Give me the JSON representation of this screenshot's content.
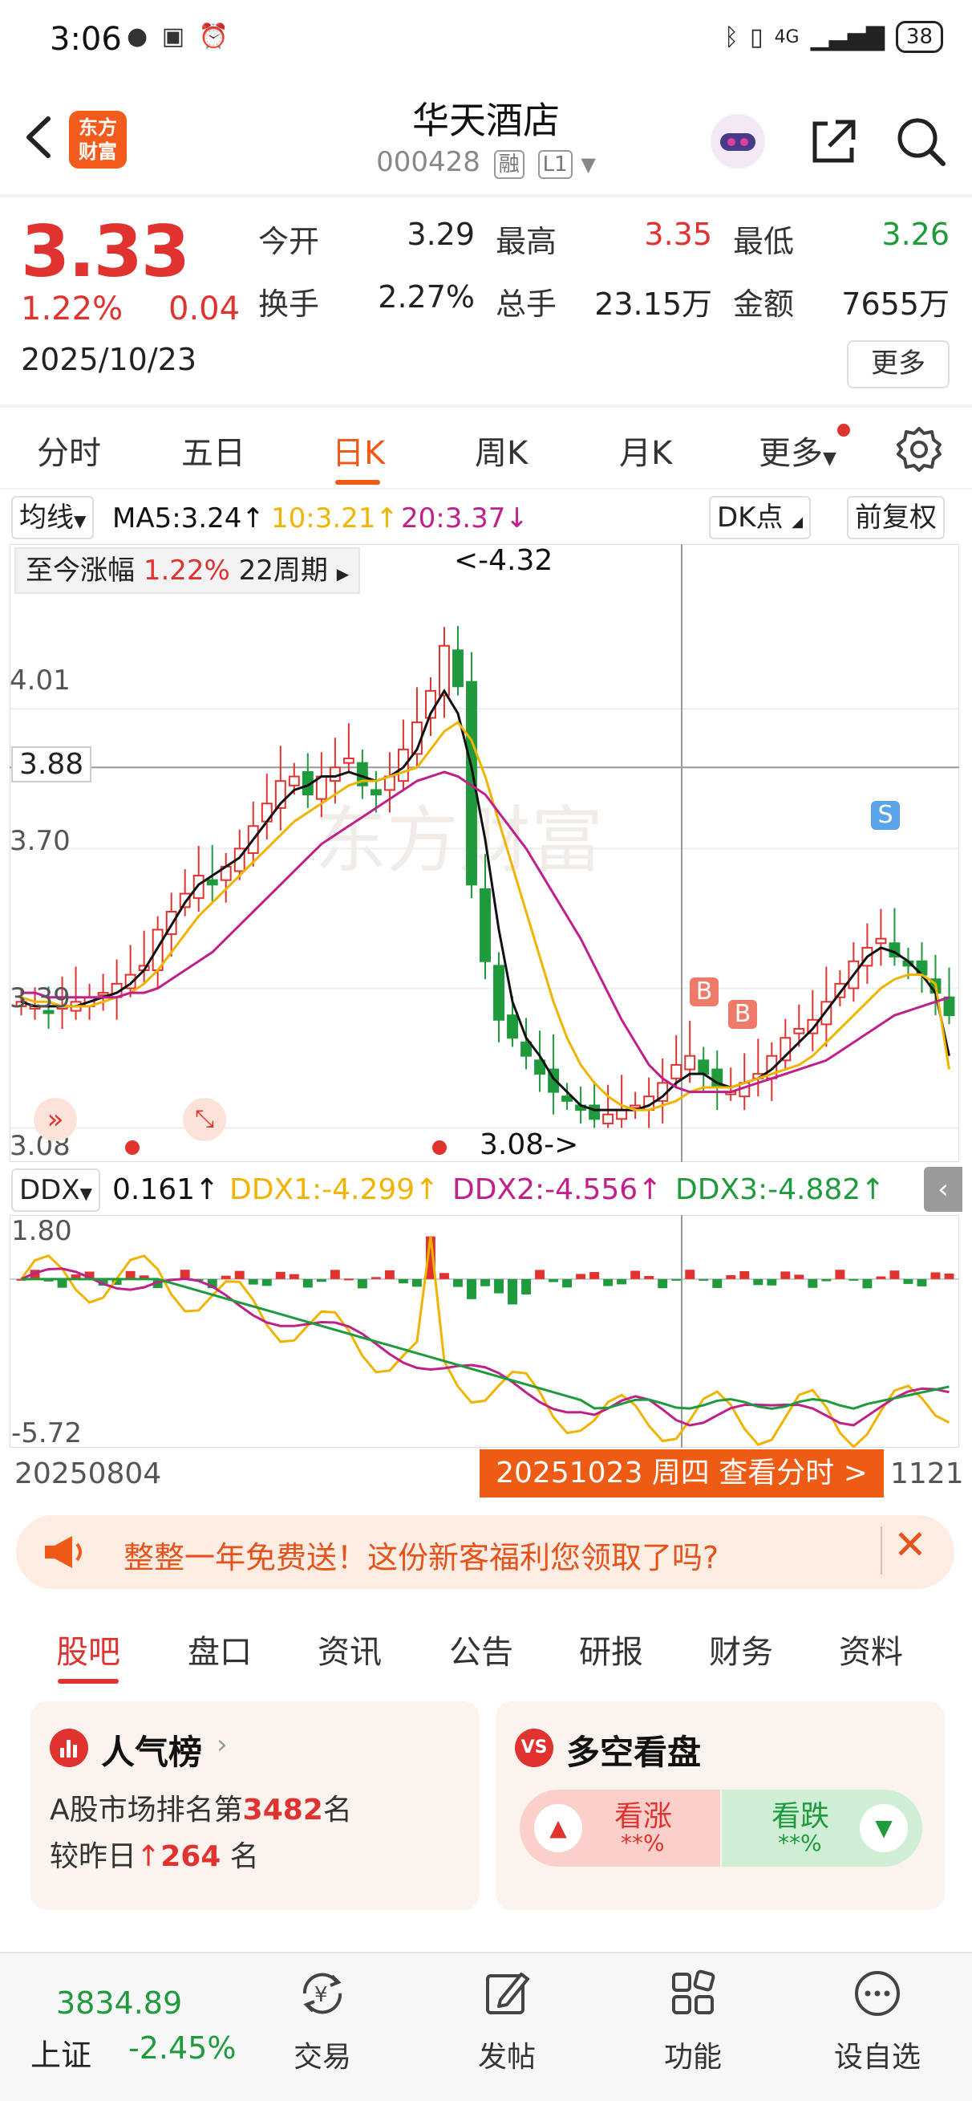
{
  "status_bar": {
    "time": "3:06",
    "battery": "38",
    "network": "4G"
  },
  "header": {
    "app_logo_line1": "东方",
    "app_logo_line2": "财富",
    "stock_name": "华天酒店",
    "stock_code": "000428",
    "tag_margin": "融",
    "tag_level": "L1"
  },
  "quote": {
    "price": "3.33",
    "change_pct": "1.22%",
    "change_amt": "0.04",
    "date": "2025/10/23",
    "open_label": "今开",
    "open_value": "3.29",
    "high_label": "最高",
    "high_value": "3.35",
    "low_label": "最低",
    "low_value": "3.26",
    "turnover_label": "换手",
    "turnover_value": "2.27%",
    "volume_label": "总手",
    "volume_value": "23.15万",
    "amount_label": "金额",
    "amount_value": "7655万",
    "more_label": "更多"
  },
  "kline_tabs": [
    "分时",
    "五日",
    "日K",
    "周K",
    "月K",
    "更多"
  ],
  "active_kline_tab": "日K",
  "ma_bar": {
    "selector": "均线",
    "ma5": "MA5:3.24↑",
    "ma10": "10:3.21↑",
    "ma20": "20:3.37↓",
    "dk_label": "DK点",
    "adjust_label": "前复权"
  },
  "chart_overlay": {
    "range_label": "至今涨幅",
    "range_pct": "1.22%",
    "range_period": "22周期",
    "high_marker": "<-4.32",
    "low_marker": "3.08->",
    "crosshair_value": "3.88",
    "buy_label": "B",
    "sell_label": "S"
  },
  "ddx_bar": {
    "selector": "DDX",
    "ddx": "0.161↑",
    "ddx1": "DDX1:-4.299↑",
    "ddx2": "DDX2:-4.556↑",
    "ddx3": "DDX3:-4.882↑"
  },
  "date_bar": {
    "start": "20250804",
    "end": "1121",
    "tip": "20251023 周四 查看分时 >"
  },
  "banner": {
    "text": "整整一年免费送！这份新客福利您领取了吗?"
  },
  "content_tabs": [
    "股吧",
    "盘口",
    "资讯",
    "公告",
    "研报",
    "财务",
    "资料"
  ],
  "active_content_tab": "股吧",
  "card_popularity": {
    "title": "人气榜",
    "rank_prefix": "A股市场排名第",
    "rank_value": "3482",
    "rank_suffix": "名",
    "change_prefix": "较昨日",
    "change_value": "264",
    "change_suffix": "名"
  },
  "card_vote": {
    "title": "多空看盘",
    "up_label": "看涨",
    "up_pct": "**%",
    "down_label": "看跌",
    "down_pct": "**%"
  },
  "bottom_nav": {
    "index_value": "3834.89",
    "index_name": "上证",
    "index_change": "-2.45%",
    "items": [
      "交易",
      "发帖",
      "功能",
      "设自选"
    ]
  },
  "colors": {
    "red": "#e0322f",
    "green": "#1f9a3c",
    "accent": "#f05a18",
    "ma5": "#111111",
    "ma10": "#f0b400",
    "ma20": "#c0208a"
  },
  "chart_data": {
    "type": "candlestick",
    "y_axis_ticks": [
      4.01,
      3.7,
      3.39,
      3.08
    ],
    "ylim": [
      3.08,
      4.32
    ],
    "x_start": "20250804",
    "x_end": "1121",
    "series": [
      {
        "name": "MA5",
        "last": 3.24
      },
      {
        "name": "10",
        "last": 3.21
      },
      {
        "name": "20",
        "last": 3.37
      }
    ],
    "closes": [
      3.36,
      3.35,
      3.34,
      3.35,
      3.36,
      3.37,
      3.38,
      3.4,
      3.42,
      3.44,
      3.52,
      3.56,
      3.6,
      3.64,
      3.62,
      3.66,
      3.7,
      3.75,
      3.8,
      3.85,
      3.86,
      3.82,
      3.86,
      3.88,
      3.9,
      3.84,
      3.82,
      3.86,
      3.92,
      3.98,
      4.05,
      4.15,
      4.06,
      3.62,
      3.45,
      3.32,
      3.28,
      3.24,
      3.2,
      3.16,
      3.14,
      3.12,
      3.1,
      3.11,
      3.12,
      3.13,
      3.15,
      3.18,
      3.22,
      3.24,
      3.2,
      3.17,
      3.16,
      3.18,
      3.2,
      3.24,
      3.28,
      3.3,
      3.32,
      3.36,
      3.4,
      3.45,
      3.48,
      3.5,
      3.46,
      3.44,
      3.42,
      3.38,
      3.33
    ],
    "ma5": [
      3.36,
      3.35,
      3.35,
      3.35,
      3.35,
      3.36,
      3.37,
      3.38,
      3.4,
      3.43,
      3.48,
      3.53,
      3.58,
      3.62,
      3.64,
      3.66,
      3.68,
      3.72,
      3.76,
      3.8,
      3.83,
      3.84,
      3.86,
      3.86,
      3.87,
      3.86,
      3.85,
      3.86,
      3.88,
      3.92,
      4.0,
      4.05,
      4.0,
      3.88,
      3.72,
      3.52,
      3.36,
      3.28,
      3.24,
      3.19,
      3.16,
      3.13,
      3.12,
      3.12,
      3.12,
      3.12,
      3.13,
      3.15,
      3.18,
      3.2,
      3.2,
      3.18,
      3.17,
      3.18,
      3.19,
      3.21,
      3.24,
      3.27,
      3.3,
      3.34,
      3.38,
      3.42,
      3.46,
      3.48,
      3.47,
      3.45,
      3.42,
      3.38,
      3.24
    ],
    "ma10": [
      3.37,
      3.36,
      3.36,
      3.35,
      3.35,
      3.35,
      3.36,
      3.37,
      3.38,
      3.4,
      3.43,
      3.47,
      3.51,
      3.55,
      3.58,
      3.61,
      3.64,
      3.67,
      3.7,
      3.73,
      3.76,
      3.78,
      3.8,
      3.82,
      3.84,
      3.85,
      3.85,
      3.86,
      3.87,
      3.88,
      3.92,
      3.96,
      3.98,
      3.94,
      3.86,
      3.76,
      3.66,
      3.56,
      3.46,
      3.36,
      3.28,
      3.22,
      3.18,
      3.15,
      3.13,
      3.12,
      3.12,
      3.13,
      3.14,
      3.16,
      3.17,
      3.17,
      3.17,
      3.18,
      3.19,
      3.2,
      3.21,
      3.22,
      3.24,
      3.27,
      3.3,
      3.33,
      3.36,
      3.39,
      3.41,
      3.42,
      3.42,
      3.4,
      3.21
    ],
    "ma20": [
      3.38,
      3.38,
      3.37,
      3.37,
      3.37,
      3.37,
      3.37,
      3.37,
      3.38,
      3.38,
      3.39,
      3.41,
      3.43,
      3.45,
      3.47,
      3.5,
      3.53,
      3.56,
      3.59,
      3.62,
      3.65,
      3.68,
      3.71,
      3.73,
      3.75,
      3.77,
      3.79,
      3.81,
      3.83,
      3.85,
      3.86,
      3.87,
      3.86,
      3.84,
      3.82,
      3.78,
      3.74,
      3.7,
      3.65,
      3.6,
      3.55,
      3.5,
      3.44,
      3.38,
      3.32,
      3.27,
      3.22,
      3.19,
      3.17,
      3.16,
      3.16,
      3.16,
      3.16,
      3.17,
      3.18,
      3.19,
      3.2,
      3.21,
      3.22,
      3.23,
      3.25,
      3.27,
      3.29,
      3.31,
      3.33,
      3.34,
      3.35,
      3.36,
      3.37
    ]
  }
}
